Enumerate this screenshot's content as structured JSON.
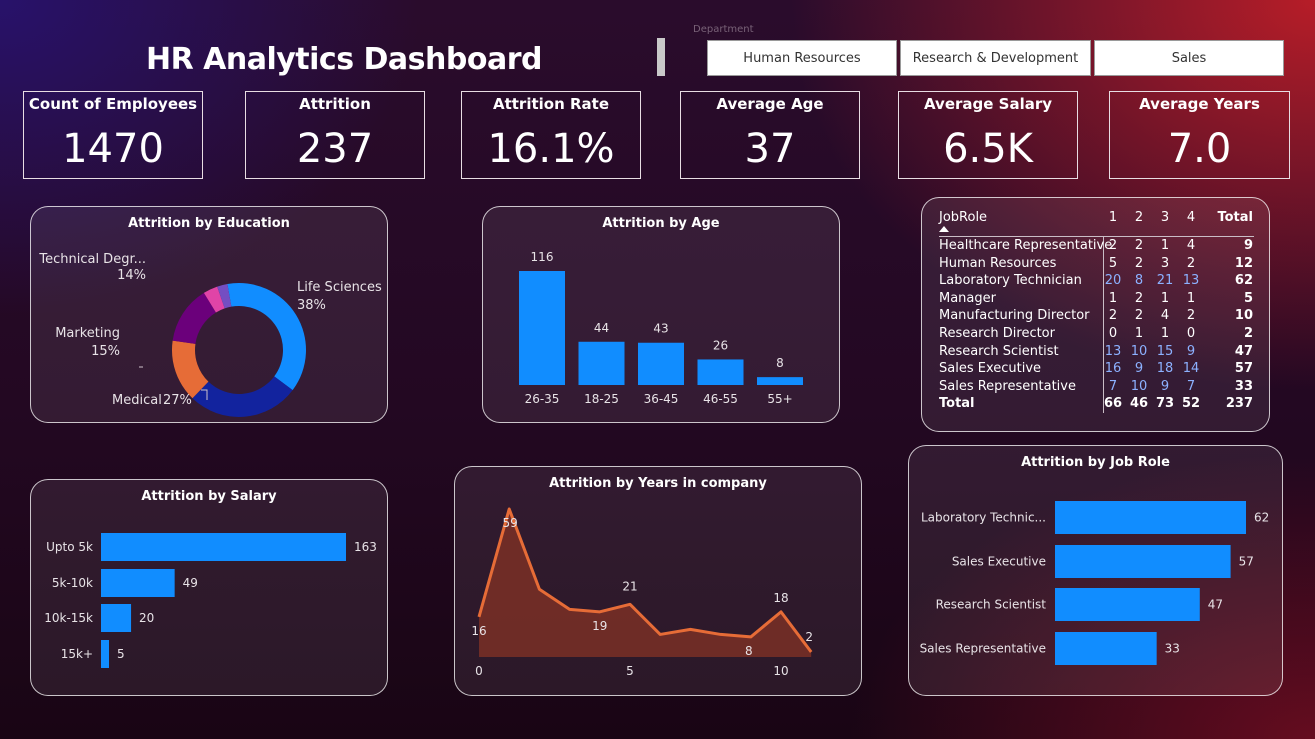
{
  "header": {
    "title": "HR Analytics Dashboard",
    "slicer_label": "Department",
    "departments": [
      "Human Resources",
      "Research & Development",
      "Sales"
    ]
  },
  "kpis": [
    {
      "label": "Count of Employees",
      "value": "1470"
    },
    {
      "label": "Attrition",
      "value": "237"
    },
    {
      "label": "Attrition Rate",
      "value": "16.1%"
    },
    {
      "label": "Average Age",
      "value": "37"
    },
    {
      "label": "Average Salary",
      "value": "6.5K"
    },
    {
      "label": "Average Years",
      "value": "7.0"
    }
  ],
  "colors": {
    "bar": "#118dff",
    "donut": [
      "#118dff",
      "#12239e",
      "#e66c37",
      "#6b007b",
      "#e044a7",
      "#744ec2"
    ],
    "area_line": "#e66c37",
    "area_fill": "#7a3026",
    "matrix_highlight": "#8cb1ff"
  },
  "matrix": {
    "header": [
      "JobRole",
      "1",
      "2",
      "3",
      "4",
      "Total"
    ],
    "rows": [
      {
        "role": "Healthcare Representative",
        "values": [
          "2",
          "2",
          "1",
          "4"
        ],
        "total": "9"
      },
      {
        "role": "Human Resources",
        "values": [
          "5",
          "2",
          "3",
          "2"
        ],
        "total": "12"
      },
      {
        "role": "Laboratory Technician",
        "values": [
          "20",
          "8",
          "21",
          "13"
        ],
        "total": "62"
      },
      {
        "role": "Manager",
        "values": [
          "1",
          "2",
          "1",
          "1"
        ],
        "total": "5"
      },
      {
        "role": "Manufacturing Director",
        "values": [
          "2",
          "2",
          "4",
          "2"
        ],
        "total": "10"
      },
      {
        "role": "Research Director",
        "values": [
          "0",
          "1",
          "1",
          "0"
        ],
        "total": "2"
      },
      {
        "role": "Research Scientist",
        "values": [
          "13",
          "10",
          "15",
          "9"
        ],
        "total": "47"
      },
      {
        "role": "Sales Executive",
        "values": [
          "16",
          "9",
          "18",
          "14"
        ],
        "total": "57"
      },
      {
        "role": "Sales Representative",
        "values": [
          "7",
          "10",
          "9",
          "7"
        ],
        "total": "33"
      }
    ],
    "total_row": {
      "role": "Total",
      "values": [
        "66",
        "46",
        "73",
        "52"
      ],
      "total": "237"
    }
  },
  "chart_data": [
    {
      "id": "education",
      "type": "pie",
      "title": "Attrition by Education",
      "slices": [
        {
          "label": "Life Sciences",
          "pct_label": "38%",
          "value": 38
        },
        {
          "label": "Medical",
          "pct_label": "27%",
          "value": 27
        },
        {
          "label": "Marketing",
          "pct_label": "15%",
          "value": 15
        },
        {
          "label": "Technical Degr...",
          "pct_label": "14%",
          "value": 14
        },
        {
          "label": "",
          "value": 3.5
        },
        {
          "label": "",
          "value": 2.5
        }
      ]
    },
    {
      "id": "age",
      "type": "bar",
      "title": "Attrition by Age",
      "categories": [
        "26-35",
        "18-25",
        "36-45",
        "46-55",
        "55+"
      ],
      "values": [
        116,
        44,
        43,
        26,
        8
      ]
    },
    {
      "id": "salary",
      "type": "bar",
      "orientation": "horizontal",
      "title": "Attrition by Salary",
      "categories": [
        "Upto 5k",
        "5k-10k",
        "10k-15k",
        "15k+"
      ],
      "values": [
        163,
        49,
        20,
        5
      ]
    },
    {
      "id": "years",
      "type": "area",
      "title": "Attrition by Years in company",
      "x": [
        0,
        1,
        2,
        3,
        4,
        5,
        6,
        7,
        8,
        9,
        10,
        11
      ],
      "values": [
        16,
        59,
        27,
        19,
        18,
        21,
        9,
        11,
        9,
        8,
        18,
        2
      ],
      "labeled_points": [
        {
          "x": 0,
          "label": "16"
        },
        {
          "x": 1,
          "label": "59"
        },
        {
          "x": 4,
          "label": "19"
        },
        {
          "x": 5,
          "label": "21"
        },
        {
          "x": 9,
          "label": "8"
        },
        {
          "x": 10,
          "label": "18"
        },
        {
          "x": 11,
          "label": "2"
        }
      ],
      "xticks": [
        "0",
        "5",
        "10"
      ],
      "xtick_values": [
        0,
        5,
        10
      ]
    },
    {
      "id": "jobrole",
      "type": "bar",
      "orientation": "horizontal",
      "title": "Attrition by Job Role",
      "categories": [
        "Laboratory Technic...",
        "Sales Executive",
        "Research Scientist",
        "Sales Representative"
      ],
      "values": [
        62,
        57,
        47,
        33
      ]
    }
  ]
}
